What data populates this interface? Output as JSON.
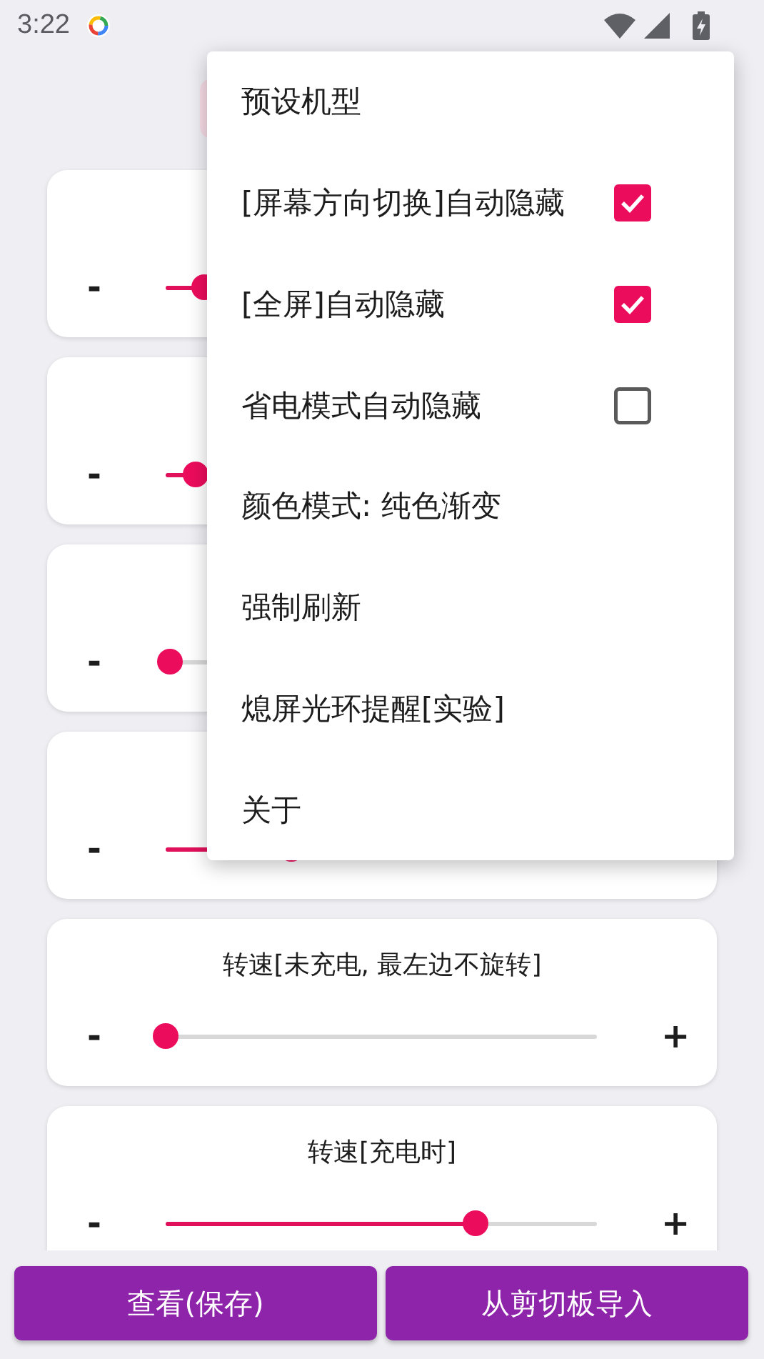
{
  "status_bar": {
    "time": "3:22"
  },
  "cards": [
    {
      "minus": "-",
      "level": 0.09
    },
    {
      "minus": "-",
      "level": 0.07
    },
    {
      "minus": "-",
      "level": 0.01
    },
    {
      "minus": "-",
      "level": 0.29
    },
    {
      "title": "转速[未充电, 最左边不旋转]",
      "minus": "-",
      "plus": "+",
      "level": 0.0
    },
    {
      "title": "转速[充电时]",
      "minus": "-",
      "plus": "+",
      "level": 0.72
    }
  ],
  "menu": [
    {
      "kind": "text",
      "label": "预设机型"
    },
    {
      "kind": "checkbox",
      "label": "[屏幕方向切换]自动隐藏",
      "checked": true
    },
    {
      "kind": "checkbox",
      "label": "[全屏]自动隐藏",
      "checked": true
    },
    {
      "kind": "checkbox",
      "label": "省电模式自动隐藏",
      "checked": false
    },
    {
      "kind": "text",
      "label": "颜色模式: 纯色渐变"
    },
    {
      "kind": "text",
      "label": "强制刷新"
    },
    {
      "kind": "text",
      "label": "熄屏光环提醒[实验]"
    },
    {
      "kind": "text",
      "label": "关于"
    }
  ],
  "buttons": [
    "查看(保存)",
    "从剪切板导入"
  ]
}
